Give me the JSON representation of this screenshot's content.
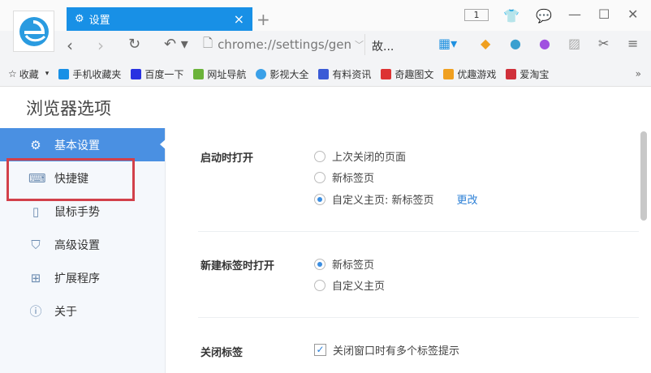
{
  "tab": {
    "title": "设置",
    "close": "×",
    "new_tab": "+"
  },
  "window": {
    "tab_count": "1"
  },
  "toolbar": {
    "address": "chrome://settings/gen",
    "search": "故..."
  },
  "bookmarks": [
    {
      "label": "收藏",
      "color": "#666"
    },
    {
      "label": "手机收藏夹",
      "color": "#1890e6"
    },
    {
      "label": "百度一下",
      "color": "#2932e1"
    },
    {
      "label": "网址导航",
      "color": "#6bb33a"
    },
    {
      "label": "影视大全",
      "color": "#3aa0e8"
    },
    {
      "label": "有料资讯",
      "color": "#3a5bd6"
    },
    {
      "label": "奇趣图文",
      "color": "#d33"
    },
    {
      "label": "优趣游戏",
      "color": "#f0a020"
    },
    {
      "label": "爱淘宝",
      "color": "#d0303a"
    }
  ],
  "page": {
    "title": "浏览器选项"
  },
  "sidebar": {
    "items": [
      {
        "label": "基本设置",
        "icon": "gear-icon"
      },
      {
        "label": "快捷键",
        "icon": "keyboard-icon"
      },
      {
        "label": "鼠标手势",
        "icon": "mouse-icon"
      },
      {
        "label": "高级设置",
        "icon": "shield-icon"
      },
      {
        "label": "扩展程序",
        "icon": "extensions-icon"
      },
      {
        "label": "关于",
        "icon": "info-icon"
      }
    ]
  },
  "sections": {
    "startup": {
      "label": "启动时打开",
      "options": [
        "上次关闭的页面",
        "新标签页",
        "自定义主页: 新标签页"
      ],
      "selected": 2,
      "change_link": "更改"
    },
    "newtab": {
      "label": "新建标签时打开",
      "options": [
        "新标签页",
        "自定义主页"
      ],
      "selected": 0
    },
    "closetab": {
      "label": "关闭标签",
      "checkbox": "关闭窗口时有多个标签提示",
      "checked": true
    }
  },
  "colors": {
    "accent": "#4a90e2",
    "tab": "#1890e6",
    "highlight": "#d2404a"
  }
}
